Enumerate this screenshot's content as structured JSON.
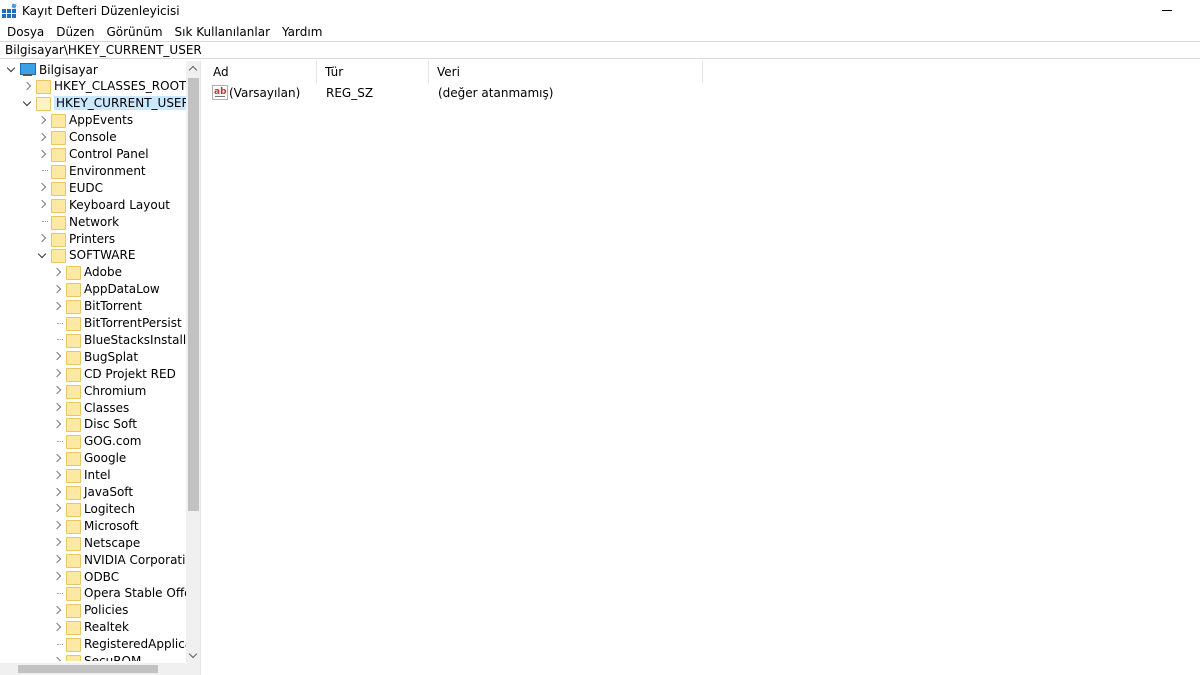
{
  "window": {
    "title": "Kayıt Defteri Düzenleyicisi"
  },
  "menu": [
    "Dosya",
    "Düzen",
    "Görünüm",
    "Sık Kullanılanlar",
    "Yardım"
  ],
  "address": "Bilgisayar\\HKEY_CURRENT_USER",
  "tree": [
    {
      "label": "Bilgisayar",
      "level": 0,
      "state": "down",
      "icon": "computer-icon"
    },
    {
      "label": "HKEY_CLASSES_ROOT",
      "level": 1,
      "state": "right",
      "icon": "folder-icon"
    },
    {
      "label": "HKEY_CURRENT_USER",
      "level": 1,
      "state": "down",
      "icon": "folder-icon",
      "selected": true
    },
    {
      "label": "AppEvents",
      "level": 2,
      "state": "right",
      "icon": "folder-icon"
    },
    {
      "label": "Console",
      "level": 2,
      "state": "right",
      "icon": "folder-icon"
    },
    {
      "label": "Control Panel",
      "level": 2,
      "state": "right",
      "icon": "folder-icon"
    },
    {
      "label": "Environment",
      "level": 2,
      "state": "none",
      "icon": "folder-icon"
    },
    {
      "label": "EUDC",
      "level": 2,
      "state": "right",
      "icon": "folder-icon"
    },
    {
      "label": "Keyboard Layout",
      "level": 2,
      "state": "right",
      "icon": "folder-icon"
    },
    {
      "label": "Network",
      "level": 2,
      "state": "none",
      "icon": "folder-icon"
    },
    {
      "label": "Printers",
      "level": 2,
      "state": "right",
      "icon": "folder-icon"
    },
    {
      "label": "SOFTWARE",
      "level": 2,
      "state": "down",
      "icon": "folder-icon"
    },
    {
      "label": "Adobe",
      "level": 3,
      "state": "right",
      "icon": "folder-icon"
    },
    {
      "label": "AppDataLow",
      "level": 3,
      "state": "right",
      "icon": "folder-icon"
    },
    {
      "label": "BitTorrent",
      "level": 3,
      "state": "right",
      "icon": "folder-icon"
    },
    {
      "label": "BitTorrentPersist",
      "level": 3,
      "state": "none",
      "icon": "folder-icon"
    },
    {
      "label": "BlueStacksInstaller",
      "level": 3,
      "state": "none",
      "icon": "folder-icon"
    },
    {
      "label": "BugSplat",
      "level": 3,
      "state": "right",
      "icon": "folder-icon"
    },
    {
      "label": "CD Projekt RED",
      "level": 3,
      "state": "right",
      "icon": "folder-icon"
    },
    {
      "label": "Chromium",
      "level": 3,
      "state": "right",
      "icon": "folder-icon"
    },
    {
      "label": "Classes",
      "level": 3,
      "state": "right",
      "icon": "folder-icon"
    },
    {
      "label": "Disc Soft",
      "level": 3,
      "state": "right",
      "icon": "folder-icon"
    },
    {
      "label": "GOG.com",
      "level": 3,
      "state": "none",
      "icon": "folder-icon"
    },
    {
      "label": "Google",
      "level": 3,
      "state": "right",
      "icon": "folder-icon"
    },
    {
      "label": "Intel",
      "level": 3,
      "state": "right",
      "icon": "folder-icon"
    },
    {
      "label": "JavaSoft",
      "level": 3,
      "state": "right",
      "icon": "folder-icon"
    },
    {
      "label": "Logitech",
      "level": 3,
      "state": "right",
      "icon": "folder-icon"
    },
    {
      "label": "Microsoft",
      "level": 3,
      "state": "right",
      "icon": "folder-icon"
    },
    {
      "label": "Netscape",
      "level": 3,
      "state": "right",
      "icon": "folder-icon"
    },
    {
      "label": "NVIDIA Corporation",
      "level": 3,
      "state": "right",
      "icon": "folder-icon"
    },
    {
      "label": "ODBC",
      "level": 3,
      "state": "right",
      "icon": "folder-icon"
    },
    {
      "label": "Opera Stable Offer",
      "level": 3,
      "state": "none",
      "icon": "folder-icon"
    },
    {
      "label": "Policies",
      "level": 3,
      "state": "right",
      "icon": "folder-icon"
    },
    {
      "label": "Realtek",
      "level": 3,
      "state": "right",
      "icon": "folder-icon"
    },
    {
      "label": "RegisteredApplicatic",
      "level": 3,
      "state": "none",
      "icon": "folder-icon"
    },
    {
      "label": "SecuROM",
      "level": 3,
      "state": "right",
      "icon": "folder-icon"
    }
  ],
  "columns": [
    "Ad",
    "Tür",
    "Veri"
  ],
  "values": [
    {
      "icon": "string-value-icon",
      "icon_text": "ab",
      "name": "(Varsayılan)",
      "type": "REG_SZ",
      "data": "(değer atanmamış)"
    }
  ],
  "colors": {
    "selection": "#cce8ff",
    "folder": "#fde9a3",
    "scroll_thumb": "#c2c2c2"
  }
}
